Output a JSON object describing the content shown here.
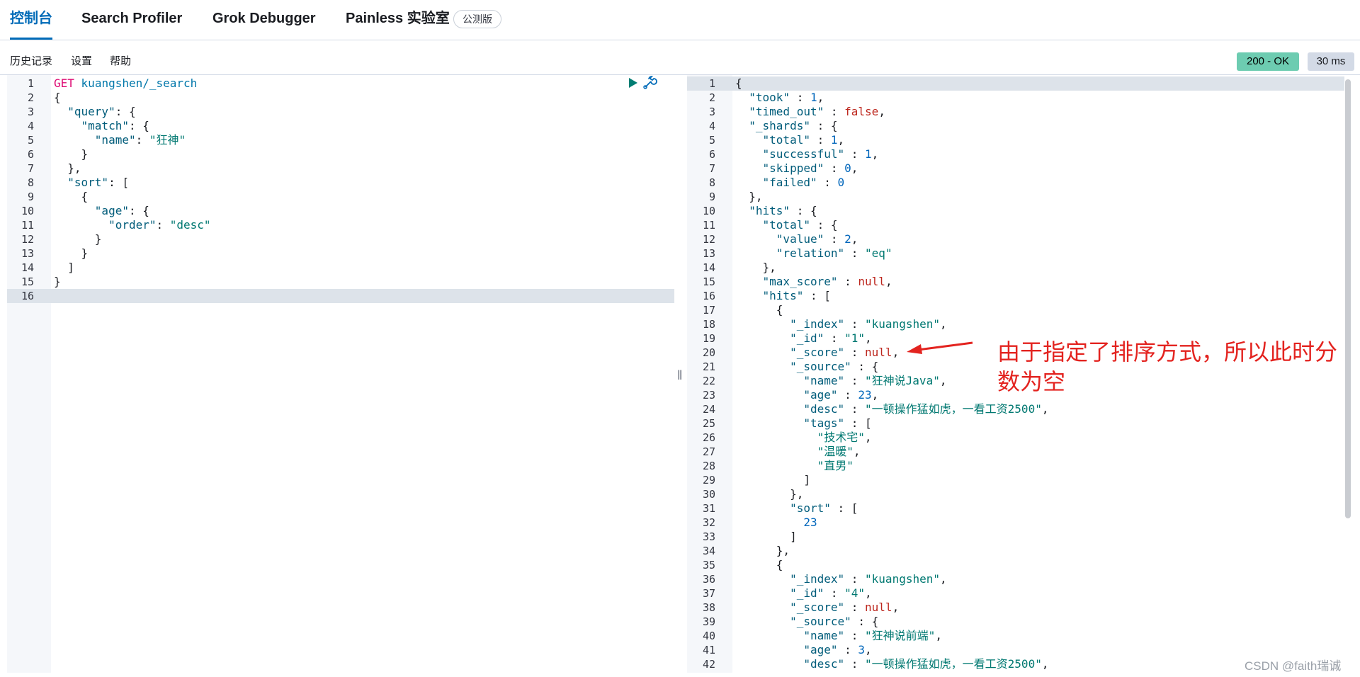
{
  "tabs": {
    "console": "控制台",
    "search_profiler": "Search Profiler",
    "grok_debugger": "Grok Debugger",
    "painless": "Painless 实验室",
    "beta_badge": "公测版"
  },
  "menu": {
    "history": "历史记录",
    "settings": "设置",
    "help": "帮助"
  },
  "status": {
    "code": "200 - OK",
    "time": "30 ms",
    "ok_color": "#6dccb1"
  },
  "request": {
    "method": "GET",
    "path": "kuangshen/_search",
    "lines": [
      "GET kuangshen/_search",
      "{",
      "  \"query\": {",
      "    \"match\": {",
      "      \"name\": \"狂神\"",
      "    }",
      "  },",
      "  \"sort\": [",
      "    {",
      "      \"age\": {",
      "        \"order\": \"desc\"",
      "      }",
      "    }",
      "  ]",
      "}",
      ""
    ]
  },
  "response": {
    "lines": [
      "{",
      "  \"took\" : 1,",
      "  \"timed_out\" : false,",
      "  \"_shards\" : {",
      "    \"total\" : 1,",
      "    \"successful\" : 1,",
      "    \"skipped\" : 0,",
      "    \"failed\" : 0",
      "  },",
      "  \"hits\" : {",
      "    \"total\" : {",
      "      \"value\" : 2,",
      "      \"relation\" : \"eq\"",
      "    },",
      "    \"max_score\" : null,",
      "    \"hits\" : [",
      "      {",
      "        \"_index\" : \"kuangshen\",",
      "        \"_id\" : \"1\",",
      "        \"_score\" : null,",
      "        \"_source\" : {",
      "          \"name\" : \"狂神说Java\",",
      "          \"age\" : 23,",
      "          \"desc\" : \"一顿操作猛如虎，一看工资2500\",",
      "          \"tags\" : [",
      "            \"技术宅\",",
      "            \"温暖\",",
      "            \"直男\"",
      "          ]",
      "        },",
      "        \"sort\" : [",
      "          23",
      "        ]",
      "      },",
      "      {",
      "        \"_index\" : \"kuangshen\",",
      "        \"_id\" : \"4\",",
      "        \"_score\" : null,",
      "        \"_source\" : {",
      "          \"name\" : \"狂神说前端\",",
      "          \"age\" : 3,",
      "          \"desc\" : \"一顿操作猛如虎，一看工资2500\","
    ]
  },
  "annotation": {
    "text": "由于指定了排序方式，所以此时分数为空",
    "color": "#e3231f"
  },
  "watermark": "CSDN @faith瑞诚"
}
